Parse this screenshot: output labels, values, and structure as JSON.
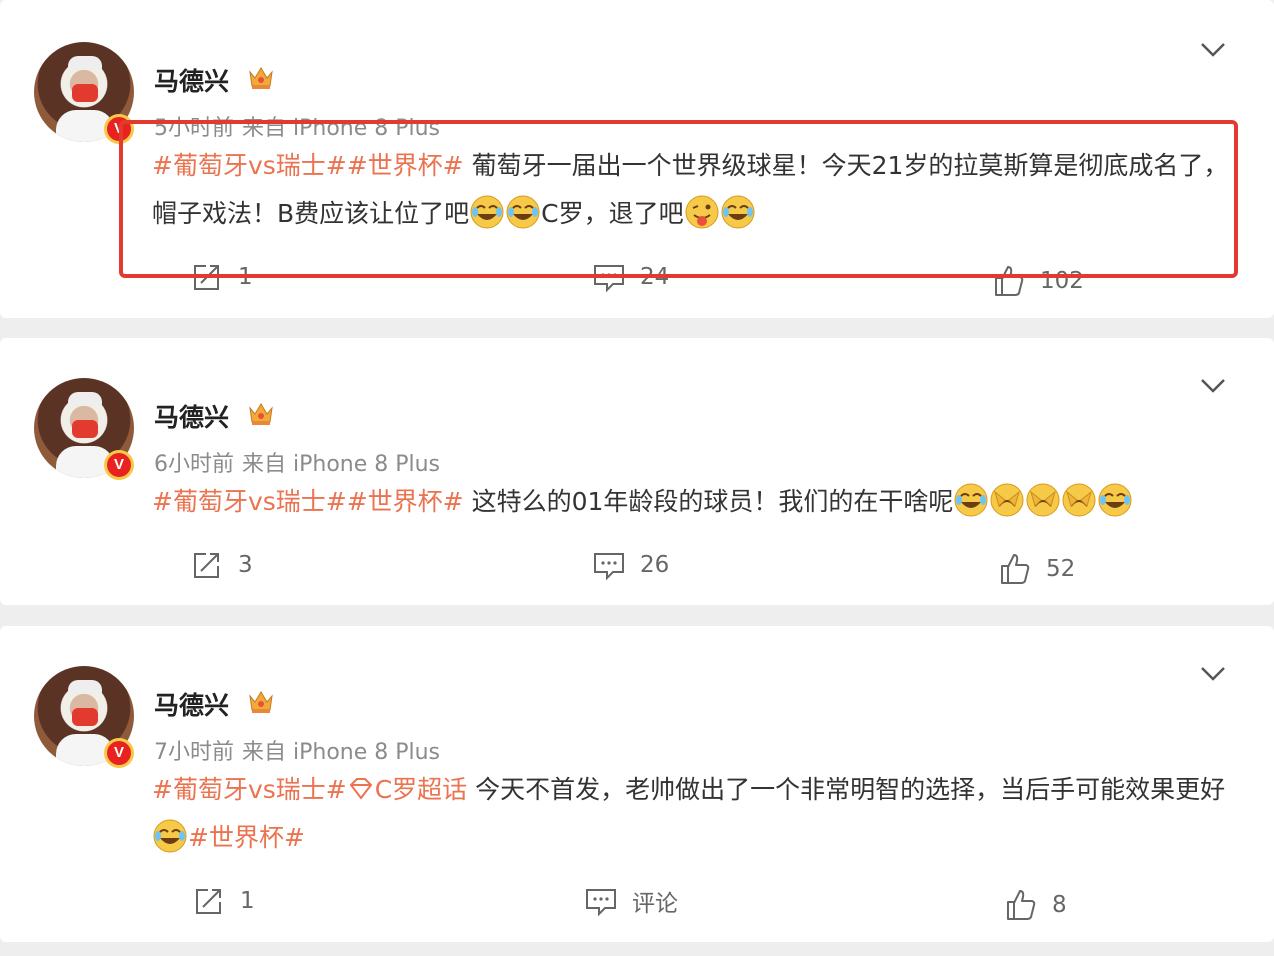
{
  "posts": [
    {
      "author": "马德兴",
      "time": "5小时前",
      "source": "来自 iPhone 8 Plus",
      "tag1": "#葡萄牙vs瑞士#",
      "tag2": "#世界杯#",
      "text1": " 葡萄牙一届出一个世界级球星！今天21岁的拉莫斯算是彻底成名了，帽子戏法！B费应该让位了吧",
      "text2": "C罗，退了吧",
      "repost": "1",
      "comment": "24",
      "like": "102"
    },
    {
      "author": "马德兴",
      "time": "6小时前",
      "source": "来自 iPhone 8 Plus",
      "tag1": "#葡萄牙vs瑞士#",
      "tag2": "#世界杯#",
      "text1": " 这特么的01年龄段的球员！我们的在干啥呢",
      "repost": "3",
      "comment": "26",
      "like": "52"
    },
    {
      "author": "马德兴",
      "time": "7小时前",
      "source": "来自 iPhone 8 Plus",
      "tag1": "#葡萄牙vs瑞士#",
      "supertopic": "C罗超话",
      "text1": " 今天不首发，老帅做出了一个非常明智的选择，当后手可能效果更好",
      "tag2": "#世界杯#",
      "repost": "1",
      "comment": "评论",
      "like": "8"
    }
  ],
  "colors": {
    "topic": "#eb7350",
    "highlight": "#e23a2e",
    "verified": "#e8231f"
  }
}
